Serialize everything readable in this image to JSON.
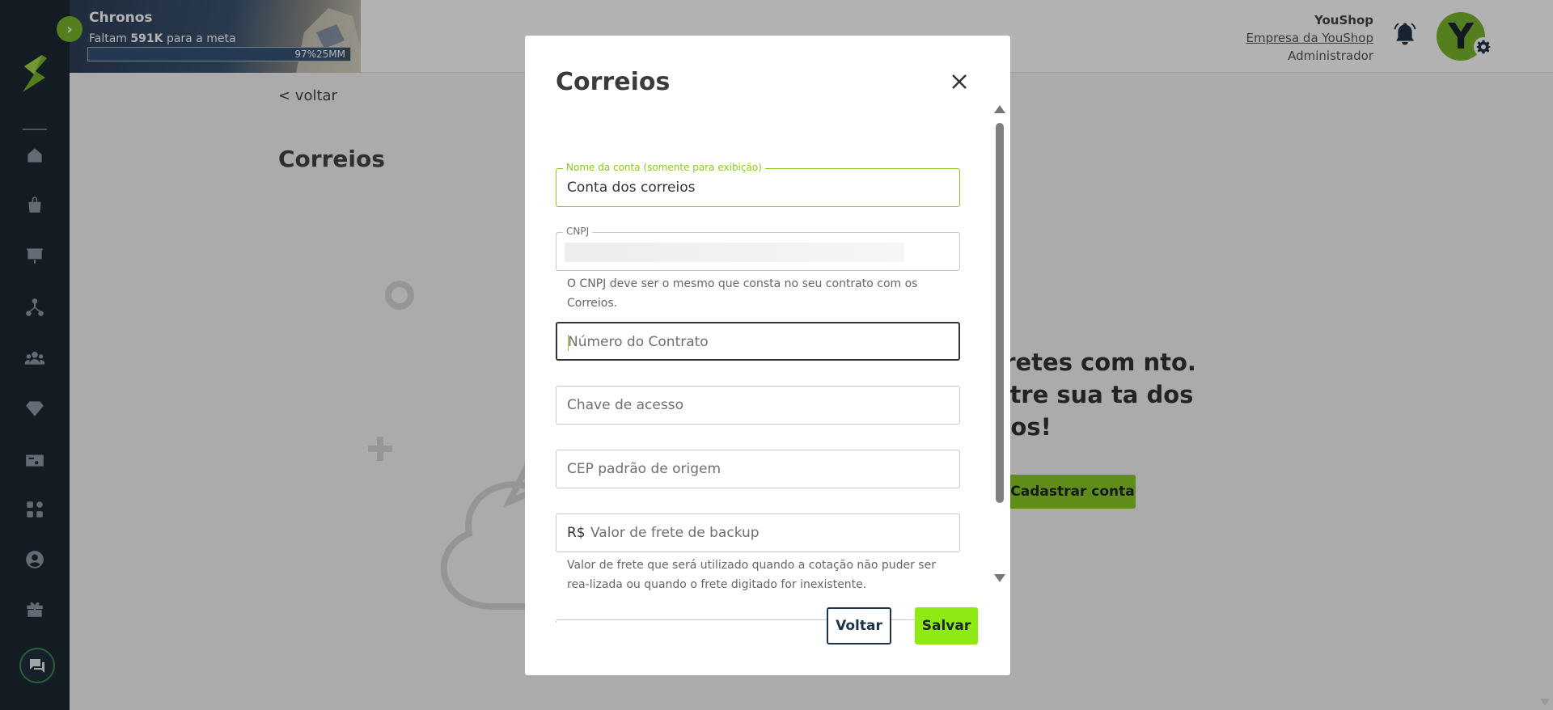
{
  "banner": {
    "title": "Chronos",
    "sub_prefix": "Faltam",
    "sub_amount": "591K",
    "sub_suffix": "para a meta",
    "progress_label": "97%25MM",
    "progress": 0.97
  },
  "user": {
    "company": "YouShop",
    "company_link": "Empresa da YouShop",
    "role": "Administrador",
    "avatar_letter": "Y"
  },
  "page": {
    "back_label": "< voltar",
    "title": "Correios",
    "empty_message": "ntre fretes com nto. Cadastre sua ta dos Correios!",
    "register_button": "Cadastrar conta"
  },
  "modal": {
    "title": "Correios",
    "fields": {
      "account_name": {
        "label": "Nome da conta (somente para exibição)",
        "value": "Conta dos correios"
      },
      "cnpj": {
        "label": "CNPJ",
        "helper": "O CNPJ deve ser o mesmo que consta no seu contrato com os Correios."
      },
      "contract_number": {
        "placeholder": "Número do Contrato"
      },
      "access_key": {
        "placeholder": "Chave de acesso"
      },
      "origin_cep": {
        "placeholder": "CEP padrão de origem"
      },
      "backup_freight": {
        "prefix": "R$",
        "placeholder": "Valor de frete de backup",
        "helper": "Valor de frete que será utilizado quando a cotação não puder ser rea-lizada ou quando o frete digitado for inexistente."
      }
    },
    "back_button": "Voltar",
    "save_button": "Salvar"
  },
  "colors": {
    "accent": "#8ac926",
    "sidebar": "#1c2733",
    "save": "#8eea12"
  },
  "icons": [
    "logo-icon",
    "home-icon",
    "bag-icon",
    "presentation-icon",
    "network-icon",
    "users-icon",
    "diamond-icon",
    "card-icon",
    "apps-icon",
    "user-circle-icon",
    "gift-icon",
    "chat-icon",
    "bell-icon",
    "gear-icon",
    "close-icon"
  ]
}
